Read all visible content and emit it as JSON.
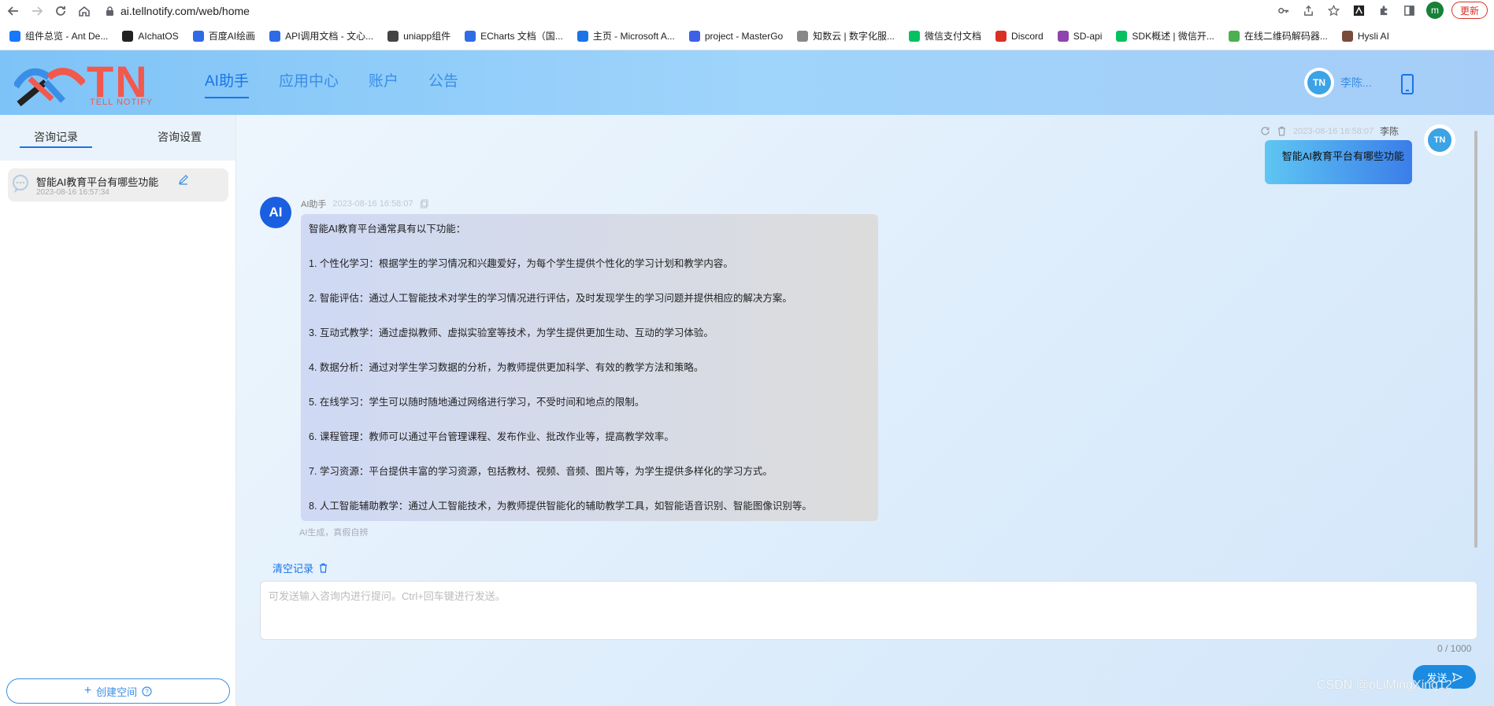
{
  "browser": {
    "url": "ai.tellnotify.com/web/home",
    "profile_initial": "m",
    "update_label": "更新"
  },
  "bookmarks": [
    {
      "label": "组件总览 - Ant De...",
      "color": "#1677ff"
    },
    {
      "label": "AIchatOS",
      "color": "#222222"
    },
    {
      "label": "百度AI绘画",
      "color": "#2f6be6"
    },
    {
      "label": "API调用文档 - 文心...",
      "color": "#2f6be6"
    },
    {
      "label": "uniapp组件",
      "color": "#444444"
    },
    {
      "label": "ECharts 文档（国...",
      "color": "#2f6be6"
    },
    {
      "label": "主页 - Microsoft A...",
      "color": "#1a73e8"
    },
    {
      "label": "project - MasterGo",
      "color": "#3e5fe8"
    },
    {
      "label": "知数云 | 数字化服...",
      "color": "#888888"
    },
    {
      "label": "微信支付文档",
      "color": "#07c160"
    },
    {
      "label": "Discord",
      "color": "#d93025"
    },
    {
      "label": "SD-api",
      "color": "#8e44ad"
    },
    {
      "label": "SDK概述 | 微信开...",
      "color": "#07c160"
    },
    {
      "label": "在线二维码解码器...",
      "color": "#4caf50"
    },
    {
      "label": "Hysli AI",
      "color": "#7a4b3a"
    }
  ],
  "header": {
    "logo_text": "TN",
    "logo_sub": "TELL NOTIFY",
    "nav": [
      {
        "label": "AI助手",
        "active": true
      },
      {
        "label": "应用中心",
        "active": false
      },
      {
        "label": "账户",
        "active": false
      },
      {
        "label": "公告",
        "active": false
      }
    ],
    "avatar_text": "TN",
    "user_name": "李陈..."
  },
  "sidebar": {
    "tabs": [
      "咨询记录",
      "咨询设置"
    ],
    "history": [
      {
        "title": "智能AI教育平台有哪些功能",
        "time": "2023-08-16 16:57:34"
      }
    ],
    "create_label": "创建空间"
  },
  "chat": {
    "user_message": {
      "time": "2023-08-16 16:58:07",
      "name": "李陈",
      "avatar_text": "TN",
      "text": "智能AI教育平台有哪些功能"
    },
    "ai_message": {
      "avatar_text": "AI",
      "name": "AI助手",
      "time": "2023-08-16 16:58:07",
      "paragraphs": [
        "智能AI教育平台通常具有以下功能：",
        "1. 个性化学习：根据学生的学习情况和兴趣爱好，为每个学生提供个性化的学习计划和教学内容。",
        "2. 智能评估：通过人工智能技术对学生的学习情况进行评估，及时发现学生的学习问题并提供相应的解决方案。",
        "3. 互动式教学：通过虚拟教师、虚拟实验室等技术，为学生提供更加生动、互动的学习体验。",
        "4. 数据分析：通过对学生学习数据的分析，为教师提供更加科学、有效的教学方法和策略。",
        "5. 在线学习：学生可以随时随地通过网络进行学习，不受时间和地点的限制。",
        "6. 课程管理：教师可以通过平台管理课程、发布作业、批改作业等，提高教学效率。",
        "7. 学习资源：平台提供丰富的学习资源，包括教材、视频、音频、图片等，为学生提供多样化的学习方式。",
        "8. 人工智能辅助教学：通过人工智能技术，为教师提供智能化的辅助教学工具，如智能语音识别、智能图像识别等。"
      ],
      "note": "AI生成，真假自辨"
    },
    "clear_label": "清空记录",
    "input_placeholder": "可发送输入咨询内进行提问。Ctrl+回车键进行发送。",
    "counter": "0 / 1000",
    "send_label": "发送"
  },
  "watermark": "CSDN @oLiMingXing12"
}
